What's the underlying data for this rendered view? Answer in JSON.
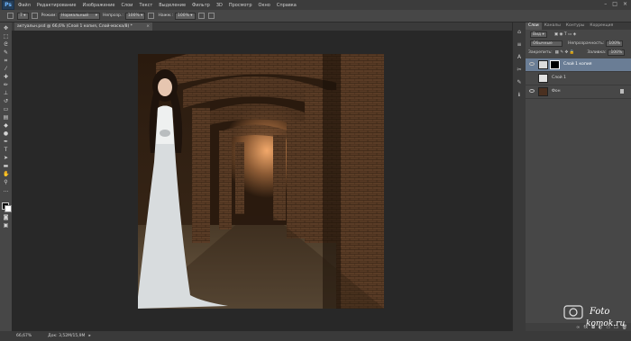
{
  "app": {
    "logo": "Ps"
  },
  "menu": [
    "Файл",
    "Редактирование",
    "Изображение",
    "Слои",
    "Текст",
    "Выделение",
    "Фильтр",
    "3D",
    "Просмотр",
    "Окно",
    "Справка"
  ],
  "window_controls": [
    "–",
    "□",
    "×"
  ],
  "options": {
    "size": "7",
    "mode_label": "Режим:",
    "mode_value": "Нормальный",
    "opacity_label": "Непрозр.:",
    "opacity_value": "100%",
    "flow_label": "Нажм.:",
    "flow_value": "100%"
  },
  "document": {
    "tab_title": "актуальн.psd @ 66,6% (Слой 1 копия, Слой-маска/8) *",
    "close": "×"
  },
  "status": {
    "zoom": "66,67%",
    "doc_size": "Док: 3,52M/15,9M"
  },
  "panels": {
    "tabs": [
      "Слои",
      "Каналы",
      "Контуры",
      "Коррекция"
    ],
    "active_tab": "Слои",
    "kind_label": "Вид",
    "blend_mode": "Обычные",
    "opacity_label": "Непрозрачность:",
    "opacity_value": "100%",
    "lock_label": "Закрепить:",
    "fill_label": "Заливка:",
    "fill_value": "100%"
  },
  "layers": [
    {
      "name": "Слой 1 копия",
      "selected": true,
      "has_mask": true
    },
    {
      "name": "Слой 1",
      "selected": false,
      "has_mask": false
    },
    {
      "name": "Фон",
      "selected": false,
      "has_mask": false,
      "locked": true
    }
  ],
  "panel_footer_icons": [
    "link-icon",
    "fx-icon",
    "mask-icon",
    "adjustment-icon",
    "folder-icon",
    "new-layer-icon",
    "trash-icon"
  ],
  "watermark": {
    "line1": "Foto",
    "line2": "komok.ru"
  },
  "colors": {
    "selected_layer": "#6a7d95",
    "ps_logo": "#263e57",
    "background": "#282828"
  }
}
